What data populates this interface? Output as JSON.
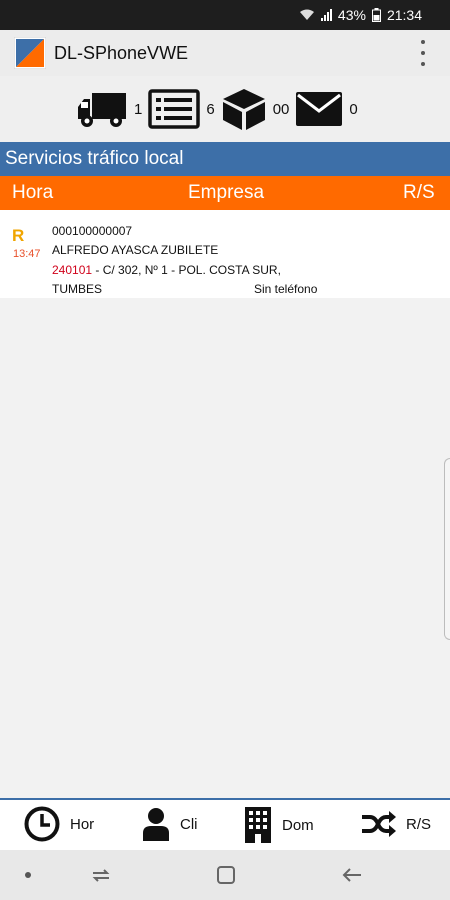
{
  "status_bar": {
    "battery": "43%",
    "time": "21:34"
  },
  "app": {
    "title": "DL-SPhoneVWE",
    "brand_colors": {
      "blue": "#3d6fa8",
      "orange": "#ff6a00"
    }
  },
  "counters": [
    {
      "icon": "truck-icon",
      "value": "1"
    },
    {
      "icon": "list-icon",
      "value": "6"
    },
    {
      "icon": "package-icon",
      "value": "00"
    },
    {
      "icon": "mail-icon",
      "value": "0"
    }
  ],
  "section": {
    "title": "Servicios tráfico local"
  },
  "columns": {
    "hora": "Hora",
    "empresa": "Empresa",
    "rs": "R/S"
  },
  "services": [
    {
      "type": "R",
      "time": "13:47",
      "code": "000100000007",
      "name": "ALFREDO AYASCA ZUBILETE",
      "postal": "240101",
      "address": " - C/ 302, Nº 1 - POL. COSTA SUR,",
      "city": "TUMBES",
      "phone": "Sin teléfono"
    }
  ],
  "bottom_nav": [
    {
      "icon": "clock-icon",
      "label": "Hor"
    },
    {
      "icon": "person-icon",
      "label": "Cli"
    },
    {
      "icon": "building-icon",
      "label": "Dom"
    },
    {
      "icon": "shuffle-icon",
      "label": "R/S"
    }
  ]
}
